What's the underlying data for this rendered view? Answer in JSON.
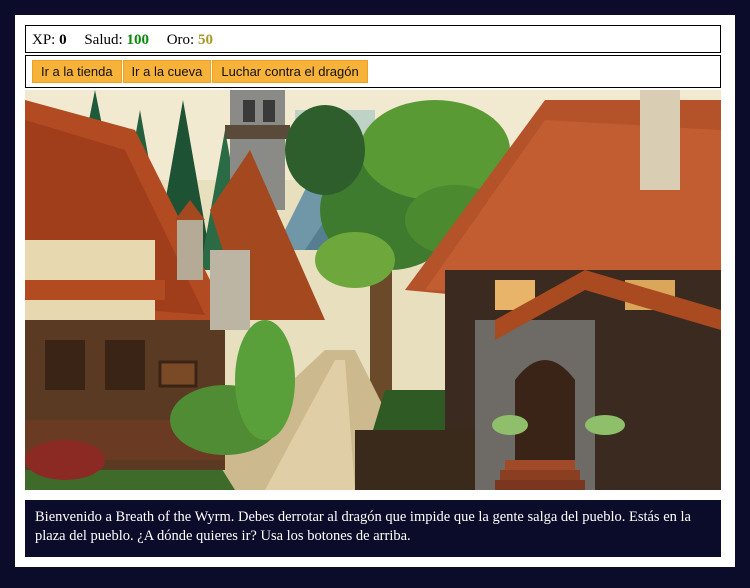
{
  "stats": {
    "xp_label": "XP:",
    "xp_value": "0",
    "health_label": "Salud:",
    "health_value": "100",
    "gold_label": "Oro:",
    "gold_value": "50"
  },
  "controls": {
    "store_label": "Ir a la tienda",
    "cave_label": "Ir a la cueva",
    "dragon_label": "Luchar contra el dragón"
  },
  "text": {
    "message": "Bienvenido a Breath of the Wyrm. Debes derrotar al dragón que impide que la gente salga del pueblo. Estás en la plaza del pueblo. ¿A dónde quieres ir? Usa los botones de arriba."
  },
  "colors": {
    "background": "#0b0c2a",
    "button": "#f7b23a",
    "health": "#0a8a0a",
    "gold": "#a89a2a"
  }
}
